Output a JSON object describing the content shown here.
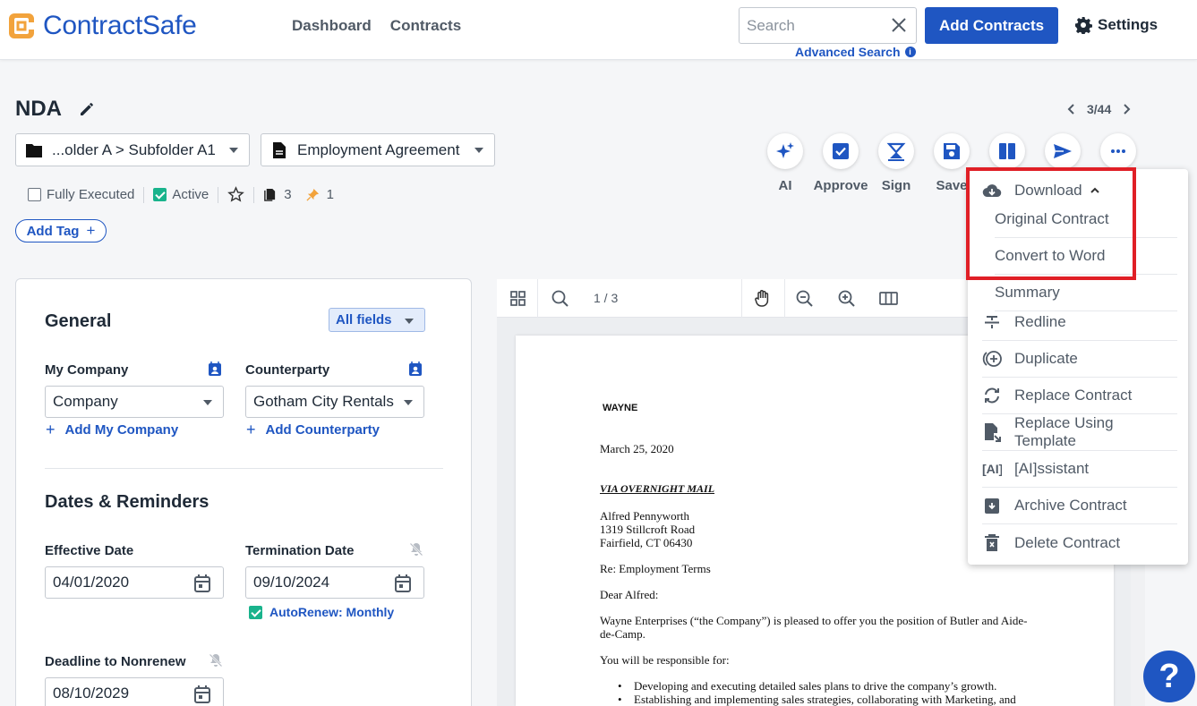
{
  "brand": {
    "name": "ContractSafe",
    "color": "#1f56c2",
    "logo_icon": "contractsafe-logo-icon"
  },
  "nav": {
    "dashboard": "Dashboard",
    "contracts": "Contracts"
  },
  "search": {
    "placeholder": "Search",
    "value": "",
    "advanced": "Advanced Search"
  },
  "header": {
    "add_contracts": "Add Contracts",
    "settings": "Settings"
  },
  "contract": {
    "title": "NDA",
    "pager": "3/44",
    "folder": "...older A > Subfolder A1",
    "type": "Employment Agreement",
    "fully_executed": "Fully Executed",
    "active": "Active",
    "file_count": "3",
    "pin_count": "1",
    "add_tag": "Add Tag"
  },
  "actions": [
    {
      "label": "AI",
      "icon": "sparkle-icon"
    },
    {
      "label": "Approve",
      "icon": "checkbox-icon"
    },
    {
      "label": "Sign",
      "icon": "signature-icon"
    },
    {
      "label": "Save",
      "icon": "save-icon"
    },
    {
      "label": "",
      "icon": "split-view-icon"
    },
    {
      "label": "",
      "icon": "send-icon"
    },
    {
      "label": "",
      "icon": "more-icon"
    }
  ],
  "general": {
    "heading": "General",
    "all_fields": "All fields",
    "my_company_label": "My Company",
    "my_company_value": "Company",
    "add_my_company": "Add My Company",
    "counterparty_label": "Counterparty",
    "counterparty_value": "Gotham City Rentals",
    "add_counterparty": "Add Counterparty"
  },
  "dates": {
    "heading": "Dates & Reminders",
    "effective_label": "Effective Date",
    "effective_value": "04/01/2020",
    "termination_label": "Termination Date",
    "termination_value": "09/10/2024",
    "autorenew": "AutoRenew: Monthly",
    "deadline_label": "Deadline to Nonrenew",
    "deadline_value": "08/10/2029"
  },
  "viewer": {
    "page": "1 / 3"
  },
  "document": {
    "company": "WAYNE",
    "date": "March 25, 2020",
    "via": "VIA OVERNIGHT MAIL",
    "address": [
      "Alfred Pennyworth",
      "1319 Stillcroft Road",
      "Fairfield, CT 06430"
    ],
    "re": "Re: Employment Terms",
    "greeting": "Dear Alfred:",
    "para1_line1": "Wayne Enterprises (“the Company”) is pleased to offer you the position of Butler and Aide-",
    "para1_line2": "de-Camp.",
    "resp": "You will be responsible for:",
    "bullets": [
      "Developing and executing detailed sales plans to drive the company’s growth.",
      "Establishing and implementing sales strategies, collaborating with Marketing, and"
    ]
  },
  "menu": {
    "download": "Download",
    "original": "Original Contract",
    "convert": "Convert to Word",
    "summary": "Summary",
    "redline": "Redline",
    "duplicate": "Duplicate",
    "replace": "Replace Contract",
    "replace_template": "Replace Using Template",
    "assistant": "[AI]ssistant",
    "archive": "Archive Contract",
    "delete": "Delete Contract"
  },
  "help": "?"
}
